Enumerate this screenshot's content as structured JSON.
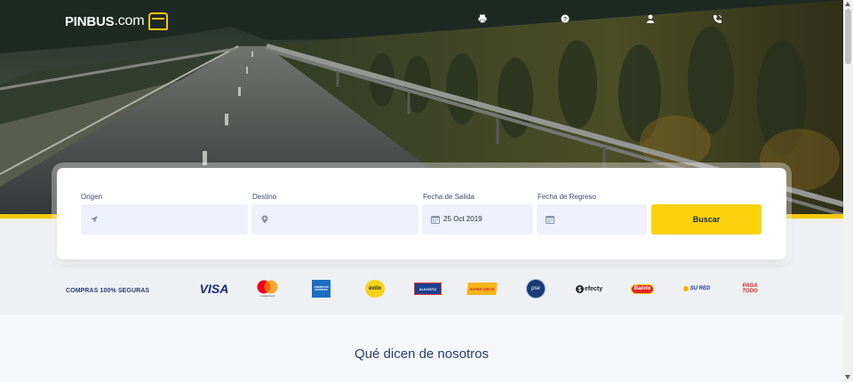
{
  "brand": {
    "name_main": "PINBUS",
    "name_suffix": ".com",
    "accent": "#f3c80a",
    "navy": "#2b3a72"
  },
  "nav": {
    "icons": [
      "print-icon",
      "help-icon",
      "user-icon",
      "phone-icon"
    ]
  },
  "search": {
    "origin": {
      "label": "Origen",
      "value": "",
      "icon": "location-arrow-icon"
    },
    "destination": {
      "label": "Destino",
      "value": "",
      "icon": "map-pin-icon"
    },
    "departure": {
      "label": "Fecha de Salida",
      "value": "25 Oct 2019",
      "icon": "calendar-icon"
    },
    "return": {
      "label": "Fecha de Regreso",
      "value": "",
      "icon": "calendar-icon"
    },
    "submit_label": "Buscar"
  },
  "payments": {
    "label": "COMPRAS 100% SEGURAS",
    "methods": [
      {
        "name": "VISA",
        "icon": "visa-logo"
      },
      {
        "name": "mastercard",
        "icon": "mastercard-logo"
      },
      {
        "name": "AMERICAN EXPRESS",
        "icon": "amex-logo"
      },
      {
        "name": "éxito",
        "icon": "exito-logo"
      },
      {
        "name": "ALKOSTO",
        "icon": "alkosto-logo"
      },
      {
        "name": "SUPER GIROS",
        "icon": "supergiros-logo"
      },
      {
        "name": "pse",
        "icon": "pse-logo"
      },
      {
        "name": "efecty",
        "icon": "efecty-logo"
      },
      {
        "name": "Baloto",
        "icon": "baloto-logo"
      },
      {
        "name": "SU RED",
        "icon": "sured-logo"
      },
      {
        "name": "PAGA TODO",
        "icon": "pagatodo-logo"
      }
    ]
  },
  "testimonials": {
    "title": "Qué dicen de nosotros"
  }
}
